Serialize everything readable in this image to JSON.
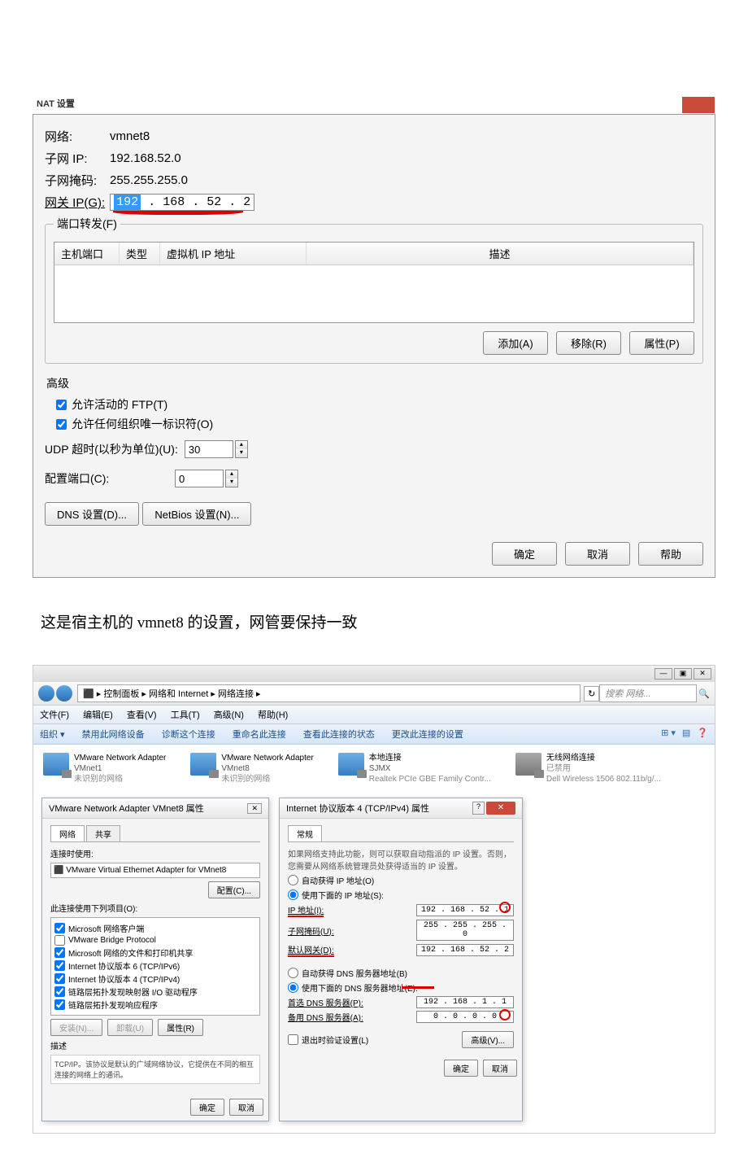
{
  "dialog1": {
    "titlebar": "NAT 设置",
    "network_label": "网络:",
    "network_value": "vmnet8",
    "subnet_label": "子网 IP:",
    "subnet_value": "192.168.52.0",
    "mask_label": "子网掩码:",
    "mask_value": "255.255.255.0",
    "gateway_label": "网关 IP(G):",
    "gateway_ip_hl": "192",
    "gateway_ip_rest": " . 168  .  52  .   2",
    "port_fwd_legend": "端口转发(F)",
    "th_host_port": "主机端口",
    "th_type": "类型",
    "th_vm_ip": "虚拟机 IP 地址",
    "th_desc": "描述",
    "btn_add": "添加(A)",
    "btn_remove": "移除(R)",
    "btn_prop": "属性(P)",
    "advanced_label": "高级",
    "cb_ftp": "允许活动的 FTP(T)",
    "cb_oui": "允许任何组织唯一标识符(O)",
    "udp_label": "UDP 超时(以秒为单位)(U):",
    "udp_value": "30",
    "cfg_port_label": "配置端口(C):",
    "cfg_port_value": "0",
    "btn_dns": "DNS 设置(D)...",
    "btn_netbios": "NetBios 设置(N)...",
    "btn_ok": "确定",
    "btn_cancel": "取消",
    "btn_help": "帮助"
  },
  "caption": "这是宿主机的 vmnet8 的设置，网管要保持一致",
  "explorer": {
    "breadcrumb": " ▸ 控制面板 ▸ 网络和 Internet ▸ 网络连接 ▸",
    "search_placeholder": "搜索 网络...",
    "refresh_icon": "↻",
    "search_icon": "🔍",
    "menu_file": "文件(F)",
    "menu_edit": "编辑(E)",
    "menu_view": "查看(V)",
    "menu_tools": "工具(T)",
    "menu_adv": "高级(N)",
    "menu_help": "帮助(H)",
    "tool_org": "组织 ▾",
    "tool_disable": "禁用此网络设备",
    "tool_diag": "诊断这个连接",
    "tool_rename": "重命名此连接",
    "tool_status": "查看此连接的状态",
    "tool_change": "更改此连接的设置",
    "adapters": [
      {
        "name": "VMware Network Adapter",
        "sub": "VMnet1",
        "grey": "未识别的网络"
      },
      {
        "name": "VMware Network Adapter",
        "sub": "VMnet8",
        "grey": "未识别的网络"
      },
      {
        "name": "本地连接",
        "sub": "SJMX",
        "grey": "Realtek PCIe GBE Family Contr..."
      },
      {
        "name": "无线网络连接",
        "sub": "已禁用",
        "grey": "Dell Wireless 1506 802.11b/g/..."
      }
    ]
  },
  "props_dlg": {
    "title": "VMware Network Adapter VMnet8 属性",
    "tab_net": "网络",
    "tab_share": "共享",
    "connect_label": "连接时使用:",
    "device": "VMware Virtual Ethernet Adapter for VMnet8",
    "btn_config": "配置(C)...",
    "items_label": "此连接使用下列项目(O):",
    "items": [
      {
        "checked": true,
        "text": "Microsoft 网络客户端"
      },
      {
        "checked": false,
        "text": "VMware Bridge Protocol"
      },
      {
        "checked": true,
        "text": "Microsoft 网络的文件和打印机共享"
      },
      {
        "checked": true,
        "text": "Internet 协议版本 6 (TCP/IPv6)"
      },
      {
        "checked": true,
        "text": "Internet 协议版本 4 (TCP/IPv4)"
      },
      {
        "checked": true,
        "text": "链路层拓扑发现映射器 I/O 驱动程序"
      },
      {
        "checked": true,
        "text": "链路层拓扑发现响应程序"
      }
    ],
    "btn_install": "安装(N)...",
    "btn_uninstall": "卸载(U)",
    "btn_props": "属性(R)",
    "desc_label": "描述",
    "desc_text": "TCP/IP。该协议是默认的广域网络协议，它提供在不同的相互连接的网络上的通讯。",
    "btn_ok": "确定",
    "btn_cancel": "取消"
  },
  "ipv4_dlg": {
    "title": "Internet 协议版本 4 (TCP/IPv4) 属性",
    "tab_general": "常规",
    "intro": "如果网络支持此功能，则可以获取自动指派的 IP 设置。否则，您需要从网络系统管理员处获得适当的 IP 设置。",
    "radio_auto_ip": "自动获得 IP 地址(O)",
    "radio_manual_ip": "使用下面的 IP 地址(S):",
    "lbl_ip": "IP 地址(I):",
    "val_ip": "192 . 168 .  52 .   1",
    "lbl_mask": "子网掩码(U):",
    "val_mask": "255 . 255 . 255 .   0",
    "lbl_gw": "默认网关(D):",
    "val_gw": "192 . 168 .  52 .   2",
    "radio_auto_dns": "自动获得 DNS 服务器地址(B)",
    "radio_manual_dns": "使用下面的 DNS 服务器地址(E):",
    "lbl_dns1": "首选 DNS 服务器(P):",
    "val_dns1": "192 . 168 .   1 .   1",
    "lbl_dns2": "备用 DNS 服务器(A):",
    "val_dns2": "0 .   0 .   0 .   0",
    "cb_validate": "退出时验证设置(L)",
    "btn_adv": "高级(V)...",
    "btn_ok": "确定",
    "btn_cancel": "取消"
  }
}
